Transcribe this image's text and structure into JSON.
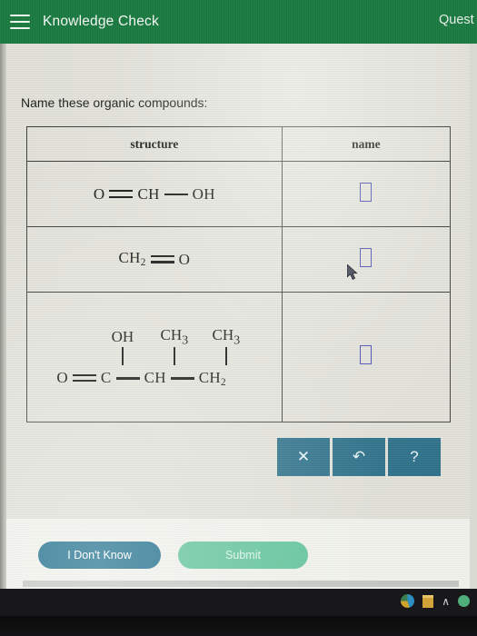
{
  "appbar": {
    "menu_icon": "hamburger-icon",
    "title": "Knowledge Check",
    "right_label": "Quest"
  },
  "content": {
    "prompt": "Name these organic compounds:"
  },
  "table": {
    "headers": {
      "structure": "structure",
      "name": "name"
    },
    "rows": [
      {
        "structure": {
          "type": "linear",
          "parts": [
            "O",
            "double-bond",
            "CH",
            "single-bond",
            "OH"
          ],
          "atom1": "O",
          "atom2": "CH",
          "atom3": "OH",
          "text": "O = CH — OH"
        },
        "answer_value": "",
        "answer_placeholder": ""
      },
      {
        "structure": {
          "type": "linear",
          "parts": [
            "CH2",
            "double-bond",
            "O"
          ],
          "atom1": "CH",
          "atom1_sub": "2",
          "atom2": "O",
          "text": "CH2 = O"
        },
        "answer_value": "",
        "answer_placeholder": ""
      },
      {
        "structure": {
          "type": "branched",
          "substituents": [
            "OH",
            "CH3",
            "CH3"
          ],
          "sub1": "OH",
          "sub2": "CH",
          "sub2_sub": "3",
          "sub3": "CH",
          "sub3_sub": "3",
          "main_atom1": "O",
          "main_atom2": "C",
          "main_atom3": "CH",
          "main_atom4": "CH",
          "main_atom4_sub": "2",
          "text": "O = C(OH) — CH(CH3) — CH2(CH3)"
        },
        "answer_value": "",
        "answer_placeholder": ""
      }
    ]
  },
  "toolbar": {
    "clear_label": "✕",
    "undo_label": "↶",
    "help_label": "?"
  },
  "footer": {
    "dont_know_label": "I Don't Know",
    "submit_label": "Submit"
  },
  "taskbar": {
    "chevron_label": "∧"
  },
  "colors": {
    "header_green": "#1b7a41",
    "answer_box_blue": "#4a4fae",
    "tool_button_teal": "#2b7089",
    "dont_know_teal": "#1f6f8c",
    "submit_green": "#63c39b"
  }
}
